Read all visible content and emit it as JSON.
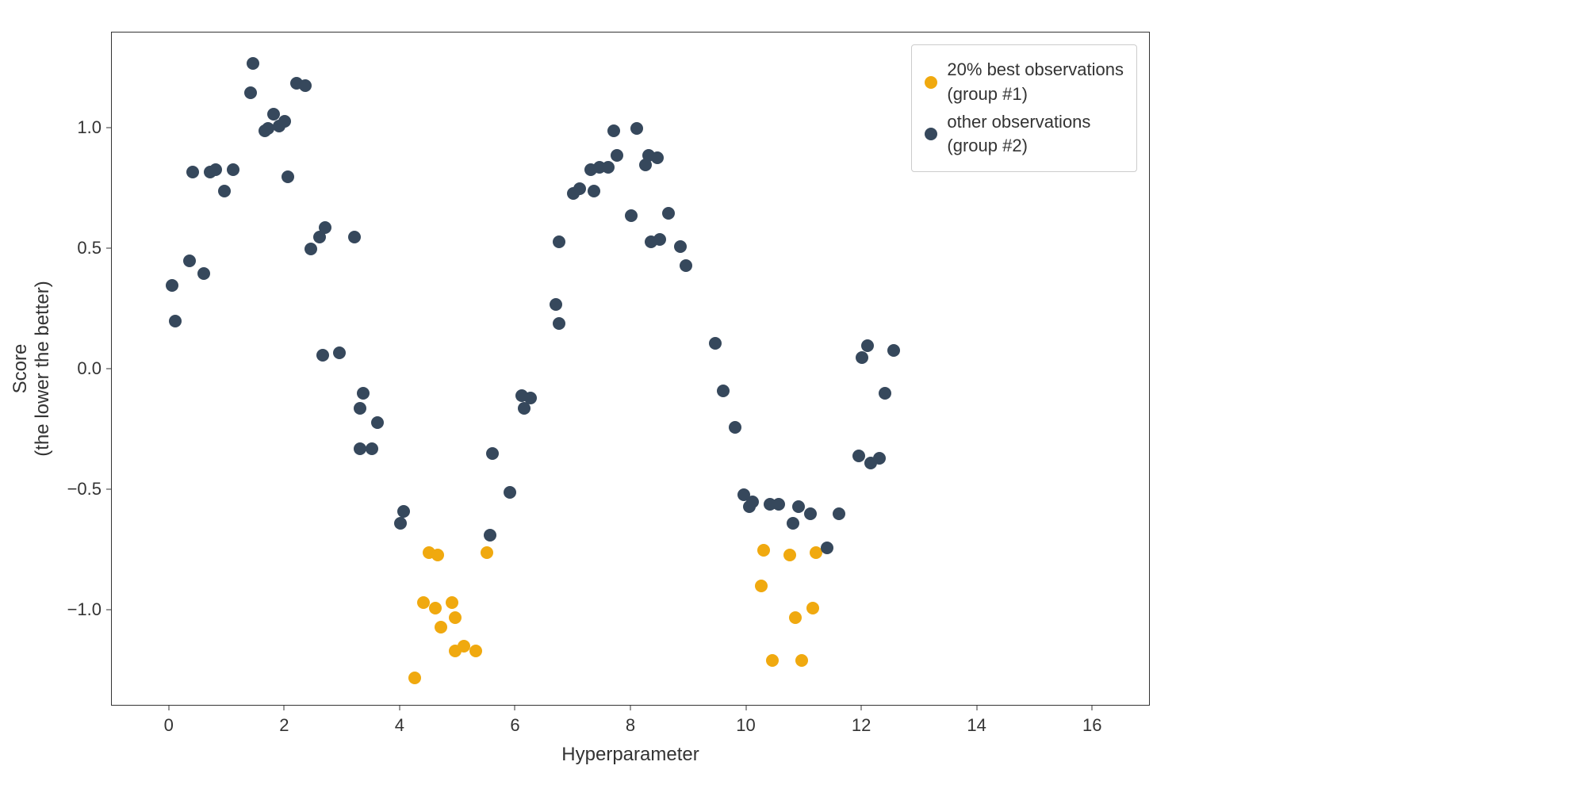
{
  "chart_data": {
    "type": "scatter",
    "xlabel": "Hyperparameter",
    "ylabel": "Score\n(the lower the better)",
    "xlim": [
      -1,
      17
    ],
    "ylim": [
      -1.4,
      1.4
    ],
    "xticks": [
      0,
      2,
      4,
      6,
      8,
      10,
      12,
      14,
      16
    ],
    "yticks": [
      -1.0,
      -0.5,
      0.0,
      0.5,
      1.0
    ],
    "series": [
      {
        "name": "20% best observations\n(group #1)",
        "color": "#f0a90f",
        "points": [
          {
            "x": 4.25,
            "y": -1.28
          },
          {
            "x": 4.4,
            "y": -0.97
          },
          {
            "x": 4.5,
            "y": -0.76
          },
          {
            "x": 4.6,
            "y": -0.99
          },
          {
            "x": 4.65,
            "y": -0.77
          },
          {
            "x": 4.7,
            "y": -1.07
          },
          {
            "x": 4.9,
            "y": -0.97
          },
          {
            "x": 4.95,
            "y": -1.03
          },
          {
            "x": 4.95,
            "y": -1.17
          },
          {
            "x": 5.1,
            "y": -1.15
          },
          {
            "x": 5.3,
            "y": -1.17
          },
          {
            "x": 5.5,
            "y": -0.76
          },
          {
            "x": 10.25,
            "y": -0.9
          },
          {
            "x": 10.3,
            "y": -0.75
          },
          {
            "x": 10.45,
            "y": -1.21
          },
          {
            "x": 10.75,
            "y": -0.77
          },
          {
            "x": 10.85,
            "y": -1.03
          },
          {
            "x": 10.95,
            "y": -1.21
          },
          {
            "x": 11.15,
            "y": -0.99
          },
          {
            "x": 11.2,
            "y": -0.76
          }
        ]
      },
      {
        "name": "other observations\n(group #2)",
        "color": "#36485c",
        "points": [
          {
            "x": 0.05,
            "y": 0.35
          },
          {
            "x": 0.1,
            "y": 0.2
          },
          {
            "x": 0.35,
            "y": 0.45
          },
          {
            "x": 0.4,
            "y": 0.82
          },
          {
            "x": 0.6,
            "y": 0.4
          },
          {
            "x": 0.7,
            "y": 0.82
          },
          {
            "x": 0.8,
            "y": 0.83
          },
          {
            "x": 0.95,
            "y": 0.74
          },
          {
            "x": 1.1,
            "y": 0.83
          },
          {
            "x": 1.4,
            "y": 1.15
          },
          {
            "x": 1.45,
            "y": 1.27
          },
          {
            "x": 1.65,
            "y": 0.99
          },
          {
            "x": 1.7,
            "y": 1.0
          },
          {
            "x": 1.8,
            "y": 1.06
          },
          {
            "x": 1.9,
            "y": 1.01
          },
          {
            "x": 2.0,
            "y": 1.03
          },
          {
            "x": 2.05,
            "y": 0.8
          },
          {
            "x": 2.2,
            "y": 1.19
          },
          {
            "x": 2.35,
            "y": 1.18
          },
          {
            "x": 2.45,
            "y": 0.5
          },
          {
            "x": 2.6,
            "y": 0.55
          },
          {
            "x": 2.65,
            "y": 0.06
          },
          {
            "x": 2.7,
            "y": 0.59
          },
          {
            "x": 2.95,
            "y": 0.07
          },
          {
            "x": 3.2,
            "y": 0.55
          },
          {
            "x": 3.3,
            "y": -0.16
          },
          {
            "x": 3.3,
            "y": -0.33
          },
          {
            "x": 3.35,
            "y": -0.1
          },
          {
            "x": 3.5,
            "y": -0.33
          },
          {
            "x": 3.6,
            "y": -0.22
          },
          {
            "x": 4.0,
            "y": -0.64
          },
          {
            "x": 4.05,
            "y": -0.59
          },
          {
            "x": 5.55,
            "y": -0.69
          },
          {
            "x": 5.6,
            "y": -0.35
          },
          {
            "x": 5.9,
            "y": -0.51
          },
          {
            "x": 6.1,
            "y": -0.11
          },
          {
            "x": 6.15,
            "y": -0.16
          },
          {
            "x": 6.25,
            "y": -0.12
          },
          {
            "x": 6.7,
            "y": 0.27
          },
          {
            "x": 6.75,
            "y": 0.53
          },
          {
            "x": 6.75,
            "y": 0.19
          },
          {
            "x": 7.0,
            "y": 0.73
          },
          {
            "x": 7.1,
            "y": 0.75
          },
          {
            "x": 7.3,
            "y": 0.83
          },
          {
            "x": 7.35,
            "y": 0.74
          },
          {
            "x": 7.45,
            "y": 0.84
          },
          {
            "x": 7.6,
            "y": 0.84
          },
          {
            "x": 7.7,
            "y": 0.99
          },
          {
            "x": 7.75,
            "y": 0.89
          },
          {
            "x": 8.0,
            "y": 0.64
          },
          {
            "x": 8.1,
            "y": 1.0
          },
          {
            "x": 8.25,
            "y": 0.85
          },
          {
            "x": 8.3,
            "y": 0.89
          },
          {
            "x": 8.35,
            "y": 0.53
          },
          {
            "x": 8.45,
            "y": 0.88
          },
          {
            "x": 8.5,
            "y": 0.54
          },
          {
            "x": 8.65,
            "y": 0.65
          },
          {
            "x": 8.85,
            "y": 0.51
          },
          {
            "x": 8.95,
            "y": 0.43
          },
          {
            "x": 9.45,
            "y": 0.11
          },
          {
            "x": 9.6,
            "y": -0.09
          },
          {
            "x": 9.8,
            "y": -0.24
          },
          {
            "x": 9.95,
            "y": -0.52
          },
          {
            "x": 10.05,
            "y": -0.57
          },
          {
            "x": 10.1,
            "y": -0.55
          },
          {
            "x": 10.4,
            "y": -0.56
          },
          {
            "x": 10.55,
            "y": -0.56
          },
          {
            "x": 10.8,
            "y": -0.64
          },
          {
            "x": 10.9,
            "y": -0.57
          },
          {
            "x": 11.1,
            "y": -0.6
          },
          {
            "x": 11.4,
            "y": -0.74
          },
          {
            "x": 11.6,
            "y": -0.6
          },
          {
            "x": 11.95,
            "y": -0.36
          },
          {
            "x": 12.0,
            "y": 0.05
          },
          {
            "x": 12.1,
            "y": 0.1
          },
          {
            "x": 12.15,
            "y": -0.39
          },
          {
            "x": 12.3,
            "y": -0.37
          },
          {
            "x": 12.4,
            "y": -0.1
          },
          {
            "x": 12.55,
            "y": 0.08
          }
        ]
      }
    ]
  }
}
